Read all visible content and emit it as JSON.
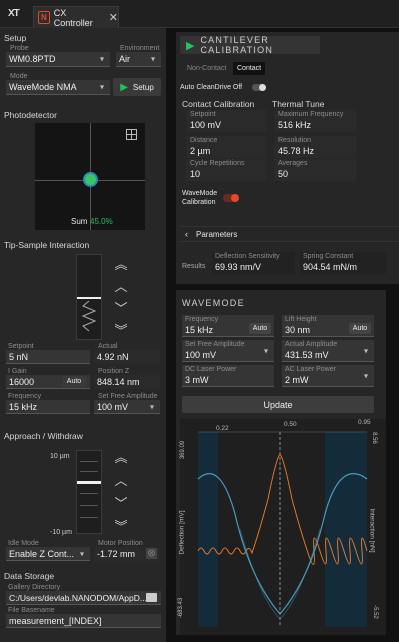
{
  "app": {
    "logo": "XT",
    "tab_title": "CX Controller"
  },
  "setup": {
    "title": "Setup",
    "probe": {
      "label": "Probe",
      "value": "WM0.8PTD"
    },
    "environment": {
      "label": "Environment",
      "value": "Air"
    },
    "mode": {
      "label": "Mode",
      "value": "WaveMode NMA"
    },
    "setup_button": "Setup"
  },
  "photodetector": {
    "title": "Photodetector",
    "sum_label": "Sum",
    "sum_value": "45.0%"
  },
  "tip_sample": {
    "title": "Tip-Sample Interaction",
    "setpoint": {
      "label": "Setpoint",
      "value": "5 nN"
    },
    "actual": {
      "label": "Actual",
      "value": "4.92 nN"
    },
    "i_gain": {
      "label": "I Gain",
      "value": "16000",
      "auto": "Auto"
    },
    "position_z": {
      "label": "Position Z",
      "value": "848.14 nm"
    },
    "frequency": {
      "label": "Frequency",
      "value": "15 kHz"
    },
    "set_free_amplitude": {
      "label": "Set Free Amplitude",
      "value": "100 mV"
    }
  },
  "approach": {
    "title": "Approach / Withdraw",
    "top_label": "10 µm",
    "bottom_label": "-10 µm",
    "idle_mode": {
      "label": "Idle Mode",
      "value": "Enable Z Cont..."
    },
    "motor_position": {
      "label": "Motor Position",
      "value": "-1.72 mm"
    }
  },
  "data_storage": {
    "title": "Data Storage",
    "gallery": {
      "label": "Gallery Directory",
      "value": "C:/Users/devlab.NANODOM/AppD..."
    },
    "basename": {
      "label": "File Basename",
      "value": "measurement_[INDEX]"
    }
  },
  "calibration": {
    "title": "CANTILEVER CALIBRATION",
    "tabs": [
      "Non-Contact",
      "Contact"
    ],
    "auto_clean": "Auto CleanDrive Off",
    "contact_title": "Contact Calibration",
    "thermal_title": "Thermal Tune",
    "setpoint": {
      "label": "Setpoint",
      "value": "100 mV"
    },
    "max_freq": {
      "label": "Maximum Frequency",
      "value": "516 kHz"
    },
    "distance": {
      "label": "Distance",
      "value": "2 µm"
    },
    "resolution": {
      "label": "Resolution",
      "value": "45.78 Hz"
    },
    "cycle": {
      "label": "Cycle Repetitions",
      "value": "10"
    },
    "averages": {
      "label": "Averages",
      "value": "50"
    },
    "wavemode_cal": "WaveMode Calibration",
    "parameters": "Parameters",
    "results_label": "Results",
    "deflection": {
      "label": "Deflection Sensitivity",
      "value": "69.93 nm/V"
    },
    "spring": {
      "label": "Spring Constant",
      "value": "904.54 mN/m"
    }
  },
  "wavemode": {
    "title": "WAVEMODE",
    "frequency": {
      "label": "Frequency",
      "value": "15 kHz",
      "auto": "Auto"
    },
    "lift": {
      "label": "Lift Height",
      "value": "30 nm",
      "auto": "Auto"
    },
    "set_free_amp": {
      "label": "Set Free Amplitude",
      "value": "100 mV"
    },
    "actual_amp": {
      "label": "Actual Amplitude",
      "value": "431.53 mV"
    },
    "dc_laser": {
      "label": "DC Laser Power",
      "value": "3 mW"
    },
    "ac_laser": {
      "label": "AC Laser Power",
      "value": "2 mW"
    },
    "update": "Update"
  },
  "plot": {
    "top_ticks": [
      "0.22",
      "0.50",
      "0.95"
    ],
    "left_top": "369.09",
    "left_bottom": "-683.43",
    "right_top": "8.56",
    "right_bottom": "-5.52",
    "ylabel_left": "Deflection [mV]",
    "ylabel_right": "Interaction [nN]"
  },
  "colors": {
    "accent_green": "#1fc45b",
    "red_toggle": "#e8482a",
    "curve_blue": "#4a9cc0",
    "curve_orange": "#e0762a"
  }
}
